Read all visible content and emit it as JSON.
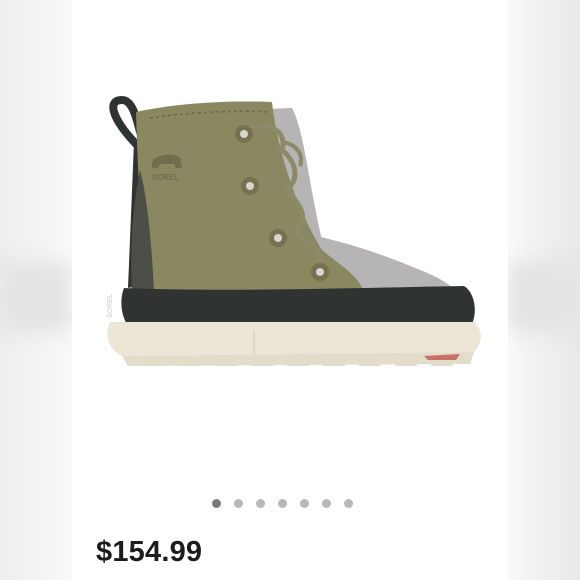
{
  "product": {
    "image_alt": "SOREL",
    "brand_mark": "SOREL",
    "heel_label": "SOREL",
    "price": "$154.99"
  },
  "carousel": {
    "dot_count": 7,
    "active_index": 0
  },
  "colors": {
    "suede": "#8a8860",
    "felt": "#b7b4b5",
    "rubber": "#2f3332",
    "sole": "#ece6d6",
    "accent_pull": "#c87065",
    "dot_active": "#7a7a7a",
    "dot_inactive": "#b8b8b8"
  }
}
